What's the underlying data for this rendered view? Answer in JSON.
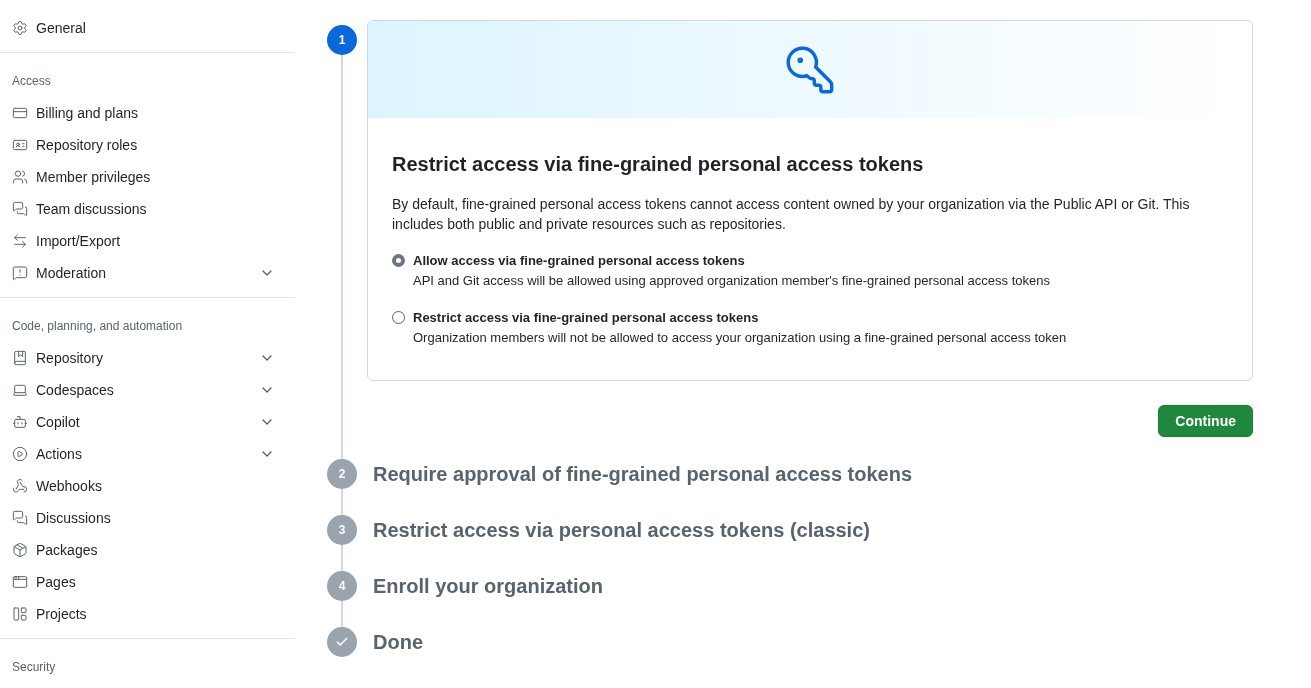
{
  "sidebar": {
    "sections": [
      {
        "items": [
          {
            "label": "General",
            "kind": "link"
          }
        ]
      },
      {
        "heading": "Access",
        "items": [
          {
            "label": "Billing and plans",
            "kind": "link"
          },
          {
            "label": "Repository roles",
            "kind": "link"
          },
          {
            "label": "Member privileges",
            "kind": "link"
          },
          {
            "label": "Team discussions",
            "kind": "link"
          },
          {
            "label": "Import/Export",
            "kind": "link"
          },
          {
            "label": "Moderation",
            "kind": "group"
          }
        ]
      },
      {
        "heading": "Code, planning, and automation",
        "items": [
          {
            "label": "Repository",
            "kind": "group"
          },
          {
            "label": "Codespaces",
            "kind": "group"
          },
          {
            "label": "Copilot",
            "kind": "group"
          },
          {
            "label": "Actions",
            "kind": "group"
          },
          {
            "label": "Webhooks",
            "kind": "link"
          },
          {
            "label": "Discussions",
            "kind": "link"
          },
          {
            "label": "Packages",
            "kind": "link"
          },
          {
            "label": "Pages",
            "kind": "link"
          },
          {
            "label": "Projects",
            "kind": "link"
          }
        ]
      },
      {
        "heading": "Security"
      }
    ]
  },
  "steps": [
    {
      "kind": "number",
      "marker": "1",
      "active": true,
      "card": {
        "title": "Restrict access via fine-grained personal access tokens",
        "description": "By default, fine-grained personal access tokens cannot access content owned by your organization via the Public API or Git. This includes both public and private resources such as repositories.",
        "options": [
          {
            "label": "Allow access via fine-grained personal access tokens",
            "note": "API and Git access will be allowed using approved organization member's fine-grained personal access tokens",
            "selected": true
          },
          {
            "label": "Restrict access via fine-grained personal access tokens",
            "note": "Organization members will not be allowed to access your organization using a fine-grained personal access token",
            "selected": false
          }
        ],
        "button": "Continue"
      }
    },
    {
      "kind": "number",
      "marker": "2",
      "active": false,
      "title": "Require approval of fine-grained personal access tokens"
    },
    {
      "kind": "number",
      "marker": "3",
      "active": false,
      "title": "Restrict access via personal access tokens (classic)"
    },
    {
      "kind": "number",
      "marker": "4",
      "active": false,
      "title": "Enroll your organization"
    },
    {
      "kind": "check",
      "active": false,
      "title": "Done"
    }
  ]
}
